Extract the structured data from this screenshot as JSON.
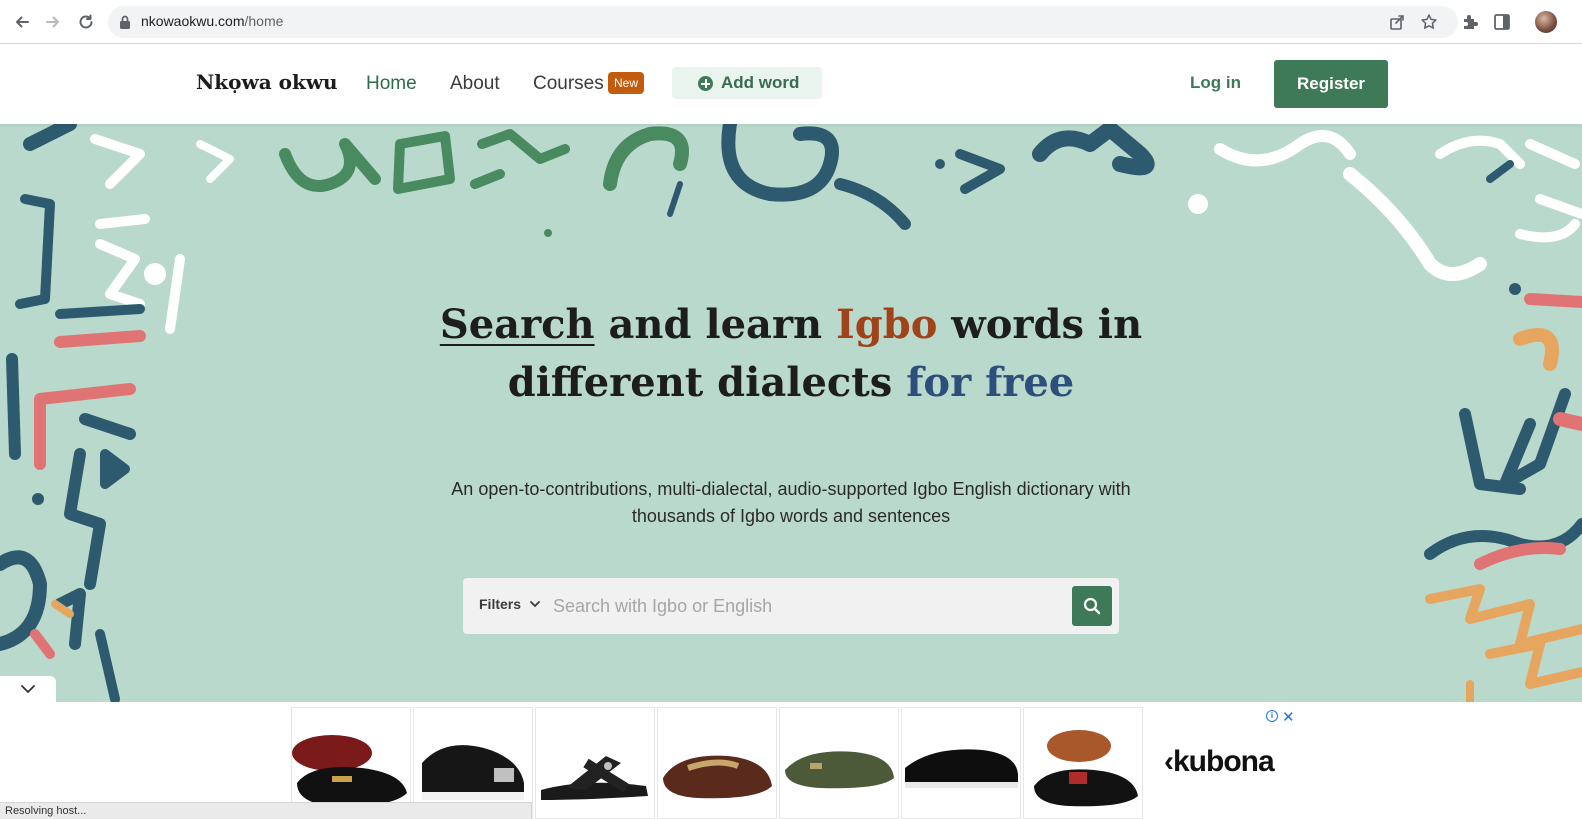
{
  "browser": {
    "url_host": "nkowaokwu.com",
    "url_path": "/home"
  },
  "header": {
    "logo": "Nkọwa okwu",
    "nav": [
      {
        "label": "Home"
      },
      {
        "label": "About"
      },
      {
        "label": "Courses"
      }
    ],
    "courses_badge": "New",
    "add_word": "Add word",
    "login": "Log in",
    "register": "Register"
  },
  "hero": {
    "title_search": "Search",
    "title_and_learn": " and learn ",
    "title_igbo": "Igbo",
    "title_words_in": " words in",
    "title_line2": "different dialects ",
    "title_for_free": "for free",
    "subtitle": "An open-to-contributions, multi-dialectal, audio-supported Igbo English dictionary with thousands of Igbo words and sentences",
    "filters_label": "Filters",
    "search_placeholder": "Search with Igbo or English"
  },
  "ad": {
    "brand": "‹kubona",
    "info": "i",
    "close": "✕"
  },
  "status": {
    "text": "Resolving host..."
  },
  "colors": {
    "brand_green": "#3f7a58",
    "hero_bg": "#b9d9cc",
    "accent_orange": "#a0421a",
    "accent_blue": "#2c4f7c",
    "badge": "#c35b0f"
  }
}
